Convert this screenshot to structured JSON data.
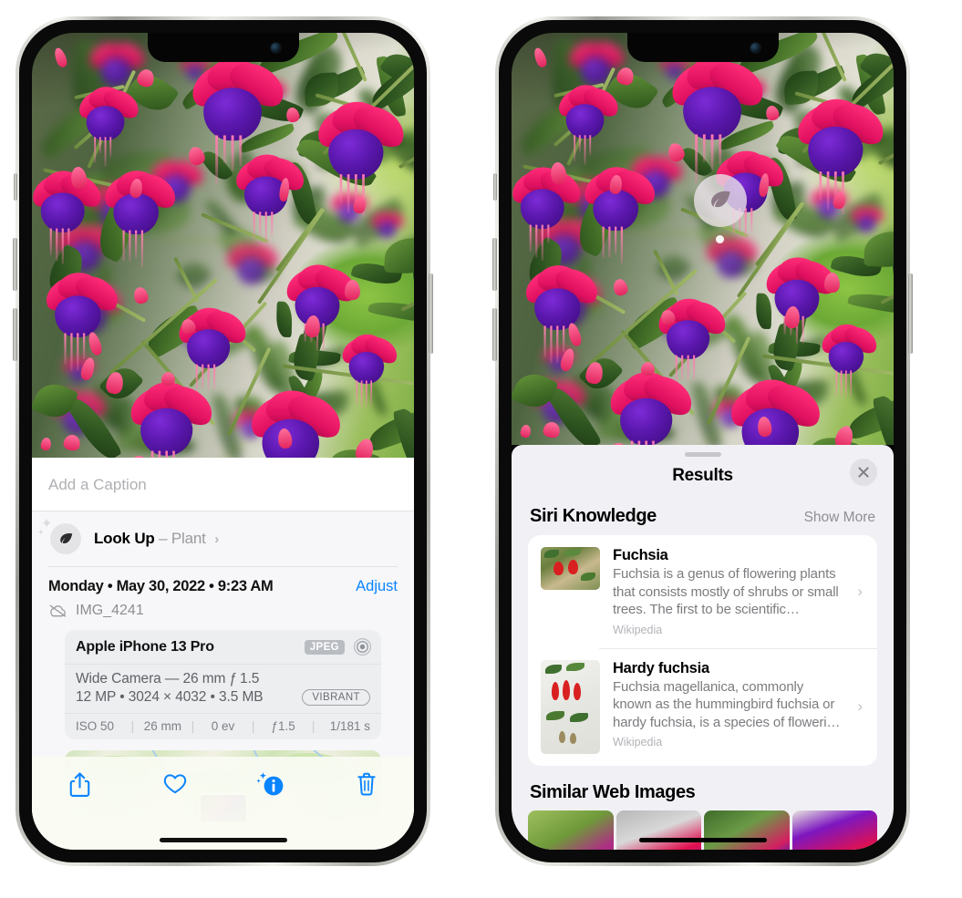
{
  "left_phone": {
    "caption_placeholder": "Add a Caption",
    "lookup": {
      "label": "Look Up",
      "dash": "–",
      "subject": "Plant",
      "chevron": "›",
      "icon": "leaf-icon"
    },
    "date_line": "Monday • May 30, 2022 • 9:23 AM",
    "adjust_label": "Adjust",
    "filename": "IMG_4241",
    "cloud_icon": "cloud-slash-icon",
    "camera_card": {
      "device": "Apple iPhone 13 Pro",
      "format_badge": "JPEG",
      "lens_icon": "aperture-icon",
      "lens_line": "Wide Camera — 26 mm ƒ 1.5",
      "specs_line": "12 MP • 3024 × 4032 • 3.5 MB",
      "style_badge": "VIBRANT",
      "exif": [
        "ISO 50",
        "26 mm",
        "0 ev",
        "ƒ1.5",
        "1/181 s"
      ],
      "exif_divider": "|"
    },
    "toolbar": [
      {
        "name": "share-button",
        "icon": "share-icon"
      },
      {
        "name": "favorite-button",
        "icon": "heart-icon"
      },
      {
        "name": "info-button",
        "icon": "info-sparkle-icon"
      },
      {
        "name": "delete-button",
        "icon": "trash-icon"
      }
    ],
    "accent_color": "#0a84ff"
  },
  "right_phone": {
    "badge": {
      "icon": "leaf-icon",
      "name": "visual-look-up-badge"
    },
    "sheet": {
      "title": "Results",
      "close_icon": "close-icon",
      "sections": [
        {
          "title": "Siri Knowledge",
          "action": "Show More",
          "items": [
            {
              "title": "Fuchsia",
              "description": "Fuchsia is a genus of flowering plants that consists mostly of shrubs or small trees. The first to be scientific…",
              "source": "Wikipedia",
              "chevron": "›"
            },
            {
              "title": "Hardy fuchsia",
              "description": "Fuchsia magellanica, commonly known as the hummingbird fuchsia or hardy fuchsia, is a species of floweri…",
              "source": "Wikipedia",
              "chevron": "›"
            }
          ]
        },
        {
          "title": "Similar Web Images",
          "images": [
            "web-image-1",
            "web-image-2",
            "web-image-3",
            "web-image-4"
          ]
        }
      ]
    }
  },
  "colors": {
    "accent": "#0a84ff",
    "sheet_bg": "#f1f1f5",
    "card_bg": "#ffffff",
    "secondary_text": "#8e8e93"
  }
}
